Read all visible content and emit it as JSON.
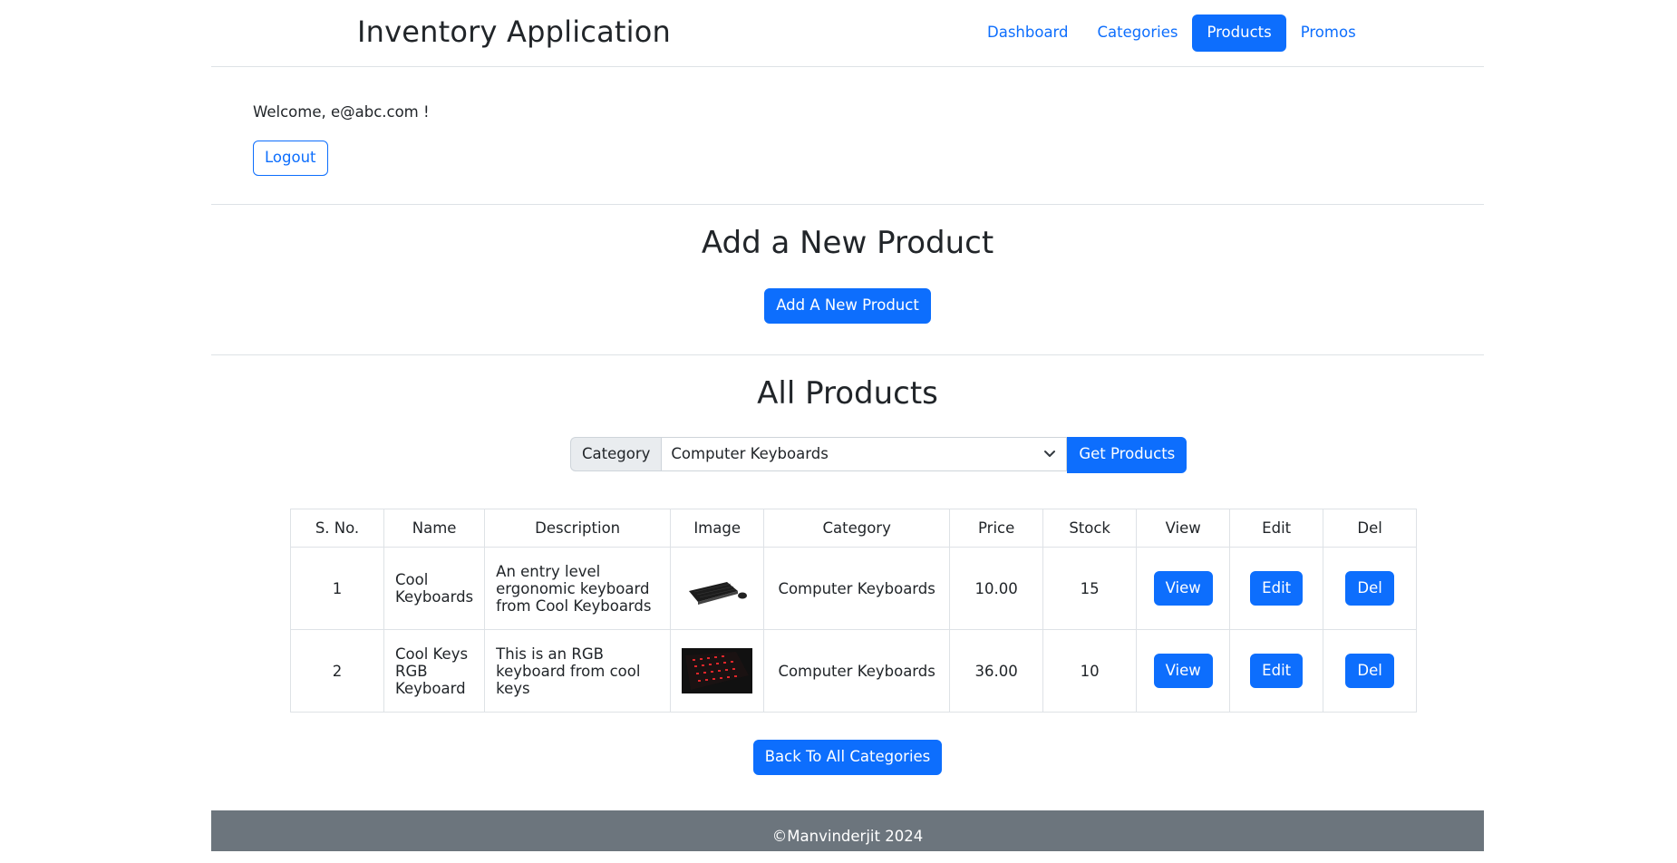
{
  "brand": "Inventory Application",
  "nav": [
    {
      "label": "Dashboard",
      "active": false
    },
    {
      "label": "Categories",
      "active": false
    },
    {
      "label": "Products",
      "active": true
    },
    {
      "label": "Promos",
      "active": false
    }
  ],
  "welcome": "Welcome, e@abc.com !",
  "logout_label": "Logout",
  "add_section": {
    "title": "Add a New Product",
    "button": "Add A New Product"
  },
  "list_section": {
    "title": "All Products"
  },
  "filter": {
    "label": "Category",
    "selected": "Computer Keyboards",
    "button": "Get Products"
  },
  "table": {
    "headers": [
      "S. No.",
      "Name",
      "Description",
      "Image",
      "Category",
      "Price",
      "Stock",
      "View",
      "Edit",
      "Del"
    ],
    "rows": [
      {
        "sno": "1",
        "name": "Cool Keyboards",
        "description": "An entry level ergonomic keyboard from Cool Keyboards",
        "image": "keyboard-mouse-image",
        "category": "Computer Keyboards",
        "price": "10.00",
        "stock": "15",
        "view": "View",
        "edit": "Edit",
        "del": "Del"
      },
      {
        "sno": "2",
        "name": "Cool Keys RGB Keyboard",
        "description": "This is an RGB keyboard from cool keys",
        "image": "rgb-keyboard-image",
        "category": "Computer Keyboards",
        "price": "36.00",
        "stock": "10",
        "view": "View",
        "edit": "Edit",
        "del": "Del"
      }
    ]
  },
  "back_button": "Back To All Categories",
  "footer": "©Manvinderjit 2024",
  "colors": {
    "primary": "#0d6efd",
    "footer_bg": "#6c757d",
    "border": "#dee2e6"
  }
}
